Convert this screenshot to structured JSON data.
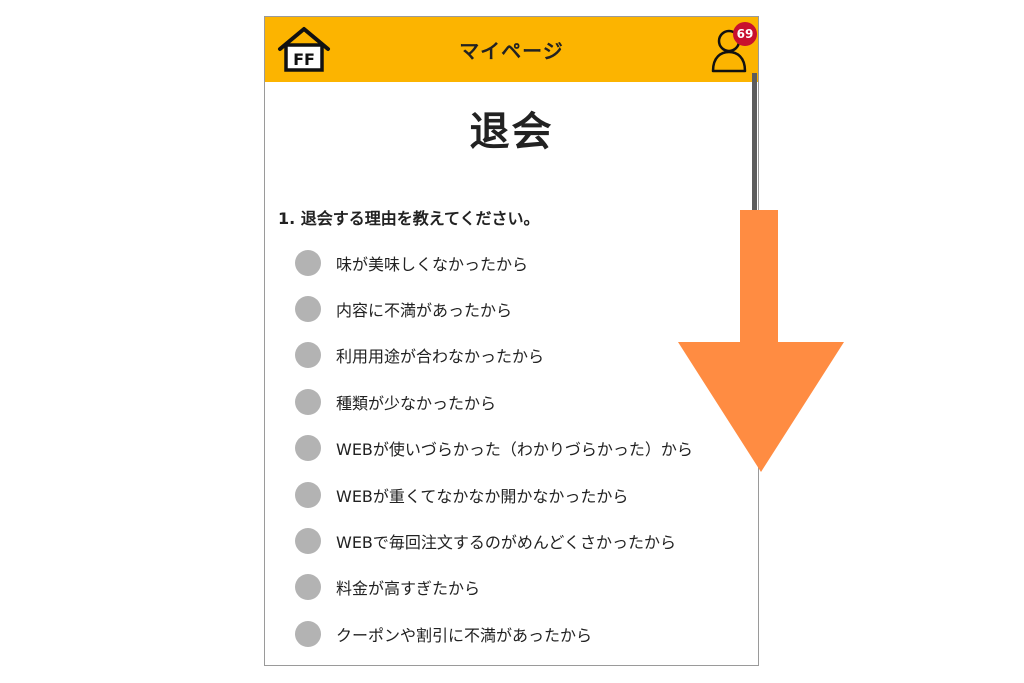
{
  "header": {
    "logo_text": "FF",
    "title": "マイページ",
    "notification_count": "69"
  },
  "page": {
    "title": "退会",
    "question": "1. 退会する理由を教えてください。"
  },
  "options": [
    {
      "label": "味が美味しくなかったから"
    },
    {
      "label": "内容に不満があったから"
    },
    {
      "label": "利用用途が合わなかったから"
    },
    {
      "label": "種類が少なかったから"
    },
    {
      "label": "WEBが使いづらかった（わかりづらかった）から"
    },
    {
      "label": "WEBが重くてなかなか開かなかったから"
    },
    {
      "label": "WEBで毎回注文するのがめんどくさかったから"
    },
    {
      "label": "料金が高すぎたから"
    },
    {
      "label": "クーポンや割引に不満があったから"
    }
  ],
  "colors": {
    "header_bg": "#fcb400",
    "badge_bg": "#c8102e",
    "radio": "#b3b3b3",
    "arrow": "#ff8c42"
  },
  "icons": {
    "logo": "home-logo-icon",
    "user": "user-icon",
    "arrow": "down-arrow-icon"
  }
}
